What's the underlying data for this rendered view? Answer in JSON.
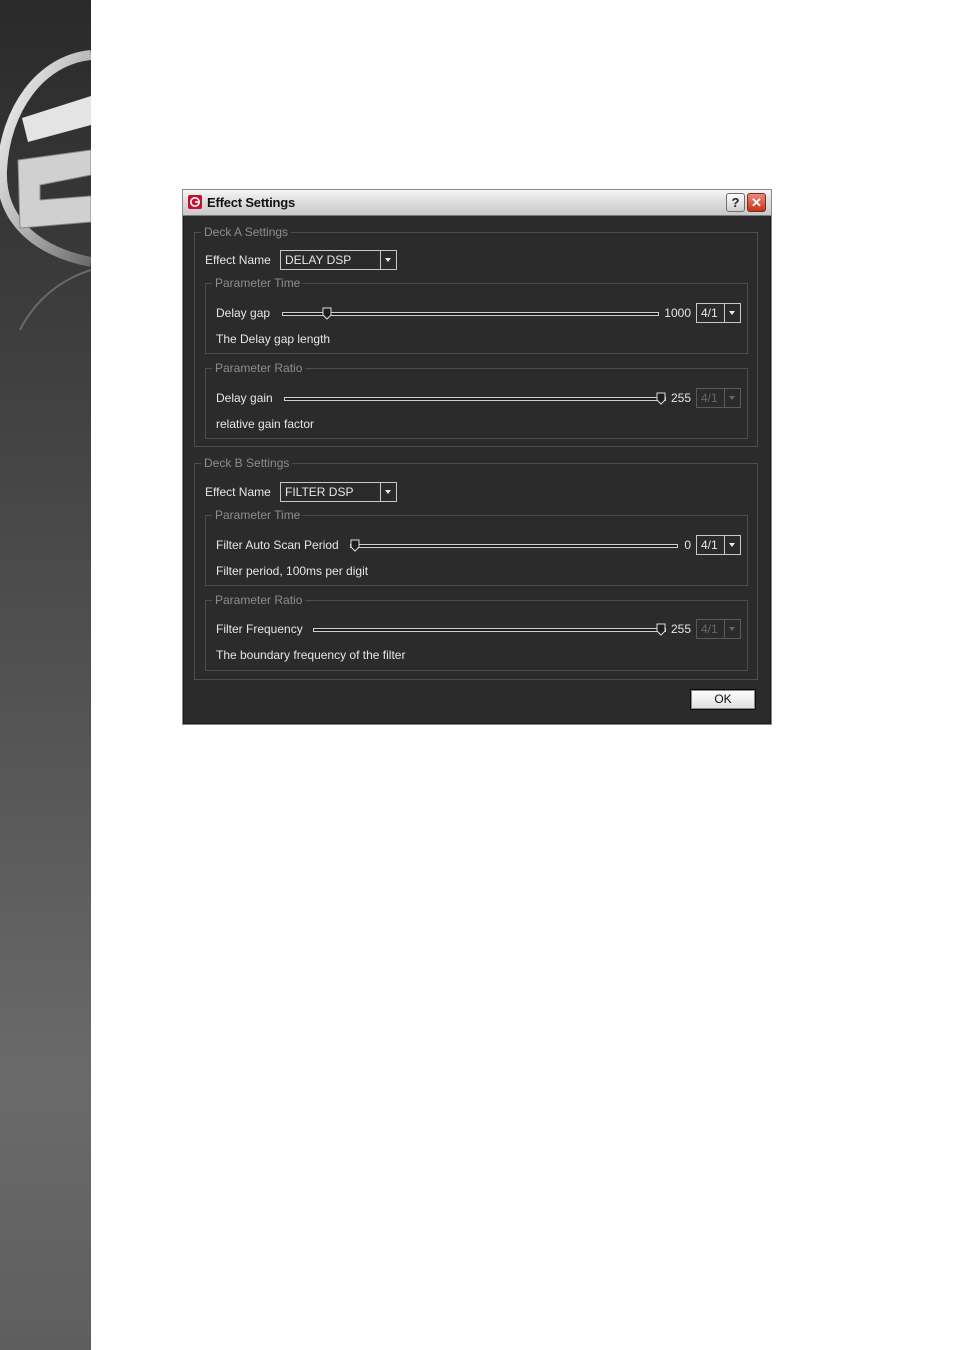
{
  "window": {
    "title": "Effect Settings",
    "help_label": "?",
    "close_label": "✕"
  },
  "deck_a": {
    "group_label": "Deck A Settings",
    "effect_name_label": "Effect Name",
    "effect_name_value": "DELAY DSP",
    "time": {
      "group_label": "Parameter Time",
      "param_label": "Delay gap",
      "value": "1000",
      "slider_fraction": 0.11,
      "ratio_value": "4/1",
      "ratio_enabled": true,
      "description": "The Delay gap length"
    },
    "ratio": {
      "group_label": "Parameter Ratio",
      "param_label": "Delay gain",
      "value": "255",
      "slider_fraction": 1.0,
      "ratio_value": "4/1",
      "ratio_enabled": false,
      "description": "relative gain factor"
    }
  },
  "deck_b": {
    "group_label": "Deck B Settings",
    "effect_name_label": "Effect Name",
    "effect_name_value": "FILTER DSP",
    "time": {
      "group_label": "Parameter Time",
      "param_label": "Filter Auto Scan Period",
      "value": "0",
      "slider_fraction": 0.0,
      "ratio_value": "4/1",
      "ratio_enabled": true,
      "description": "Filter period, 100ms per digit"
    },
    "ratio": {
      "group_label": "Parameter Ratio",
      "param_label": "Filter Frequency",
      "value": "255",
      "slider_fraction": 1.0,
      "ratio_value": "4/1",
      "ratio_enabled": false,
      "description": "The boundary frequency of the filter"
    }
  },
  "footer": {
    "ok_label": "OK"
  }
}
